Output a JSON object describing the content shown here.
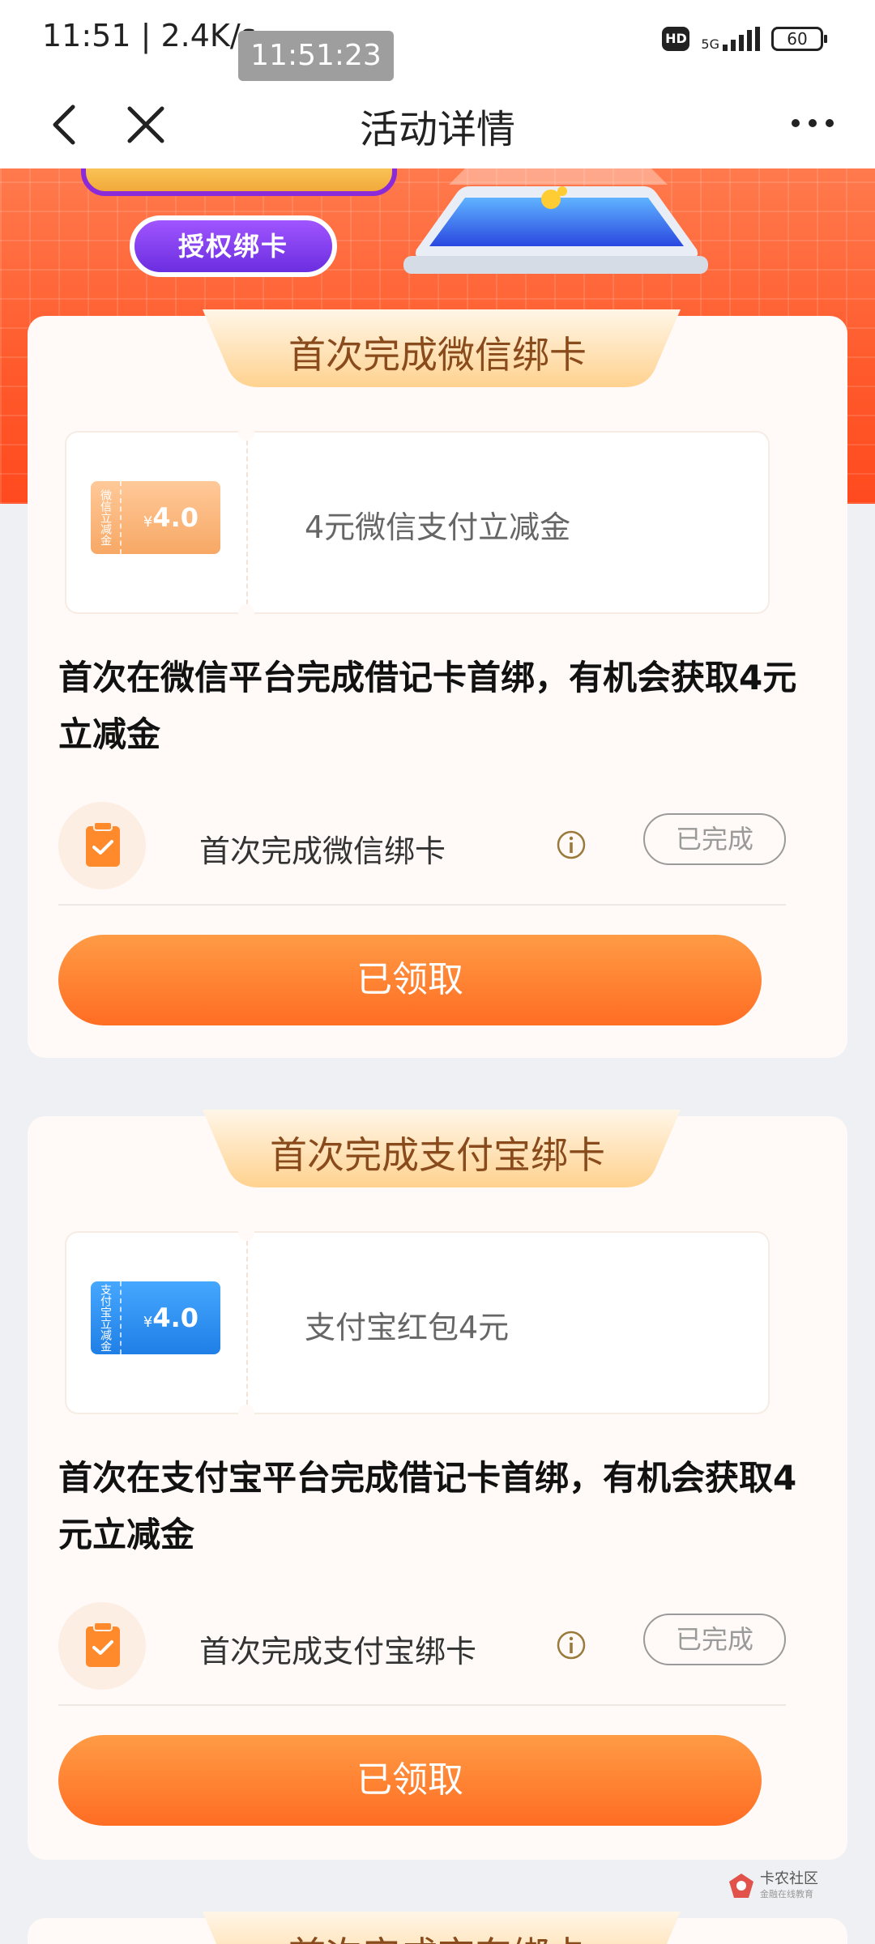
{
  "status_bar": {
    "time_network": "11:51 | 2.4K/s",
    "time_overlay": "11:51:23",
    "hd": "HD",
    "network": "5G",
    "battery": "60"
  },
  "nav": {
    "title": "活动详情"
  },
  "banner": {
    "auth_button": "授权绑卡"
  },
  "cards": [
    {
      "header": "首次完成微信绑卡",
      "ticket_side": "微信立减金",
      "ticket_currency": "¥",
      "ticket_amount": "4.0",
      "coupon_text": "4元微信支付立减金",
      "description": "首次在微信平台完成借记卡首绑，有机会获取4元立减金",
      "task_label": "首次完成微信绑卡",
      "task_status": "已完成",
      "claim_button": "已领取"
    },
    {
      "header": "首次完成支付宝绑卡",
      "ticket_side": "支付宝立减金",
      "ticket_currency": "¥",
      "ticket_amount": "4.0",
      "coupon_text": "支付宝红包4元",
      "description": "首次在支付宝平台完成借记卡首绑，有机会获取4元立减金",
      "task_label": "首次完成支付宝绑卡",
      "task_status": "已完成",
      "claim_button": "已领取"
    },
    {
      "header": "首次完成京东绑卡"
    }
  ],
  "watermark": {
    "name": "卡农社区",
    "sub": "金融在线教育"
  },
  "colors": {
    "accent_orange": "#ff7a30",
    "banner_red": "#ff5a2c",
    "header_text": "#8a4b1c",
    "wechat_ticket": "#f7a865",
    "alipay_ticket": "#1f7fe6"
  }
}
